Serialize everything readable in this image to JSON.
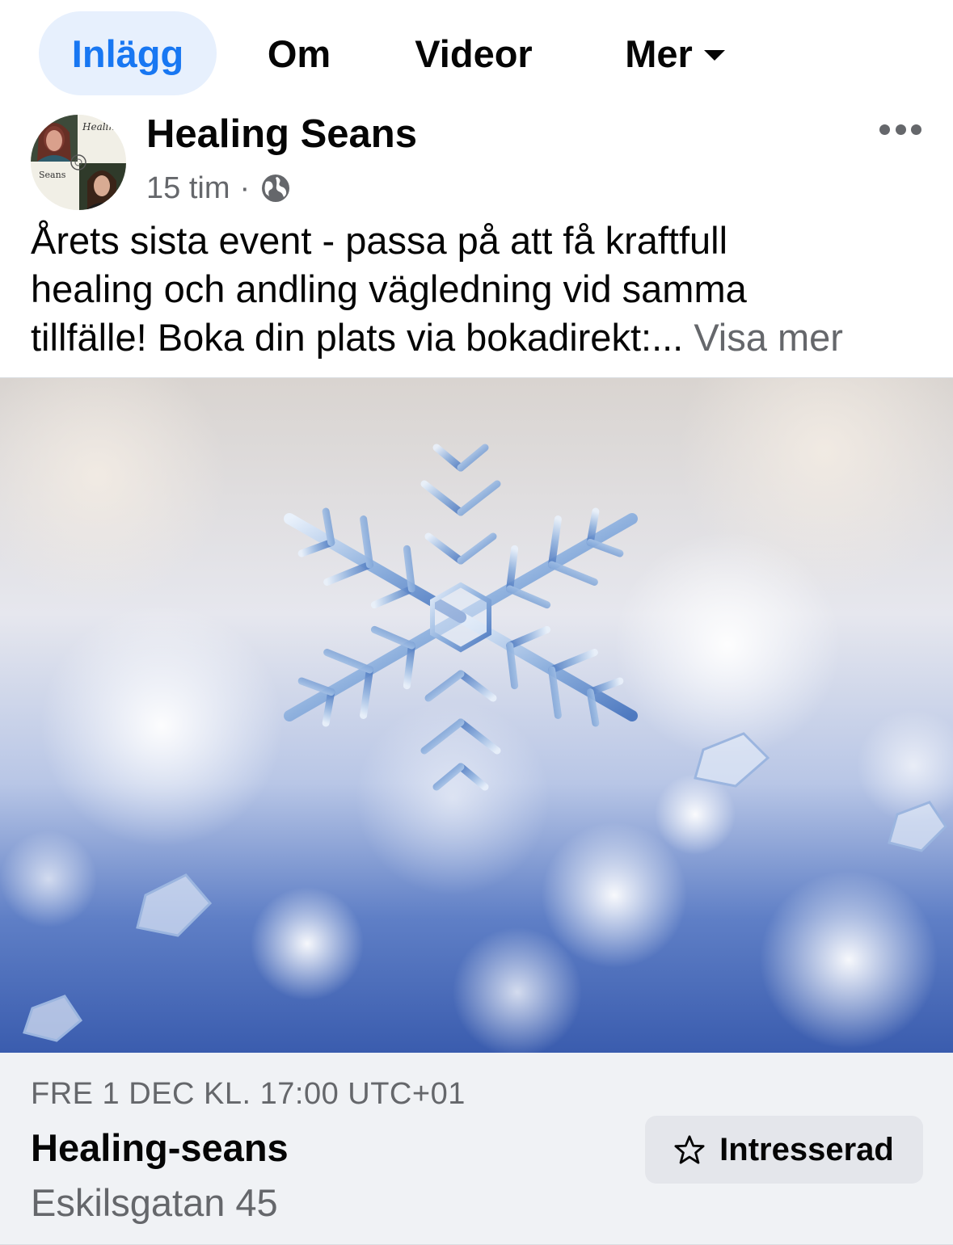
{
  "tabs": [
    {
      "label": "Inlägg",
      "active": true
    },
    {
      "label": "Om",
      "active": false
    },
    {
      "label": "Videor",
      "active": false
    },
    {
      "label": "Mer",
      "active": false
    }
  ],
  "post": {
    "author": "Healing Seans",
    "avatar_text_top": "Healing",
    "avatar_text_bottom": "Seans",
    "time": "15 tim",
    "separator": "·",
    "audience_icon": "globe-icon",
    "more_icon": "more-horizontal-icon",
    "text_lines": [
      "Årets sista event - passa på att få kraftfull",
      "healing och andling vägledning vid samma",
      "tillfälle! Boka din plats via bokadirekt:..."
    ],
    "see_more": "Visa mer",
    "image_subject": "snowflake-photo"
  },
  "event": {
    "date": "FRE 1 DEC KL. 17:00 UTC+01",
    "title": "Healing-seans",
    "location": "Eskilsgatan 45",
    "interest_label": "Intresserad",
    "interest_icon": "star-icon"
  },
  "colors": {
    "accent": "#1877f2",
    "active_tab_bg": "#e7f0fd",
    "secondary_text": "#65676b",
    "card_bg": "#f0f2f5",
    "button_bg": "#e4e6eb"
  }
}
